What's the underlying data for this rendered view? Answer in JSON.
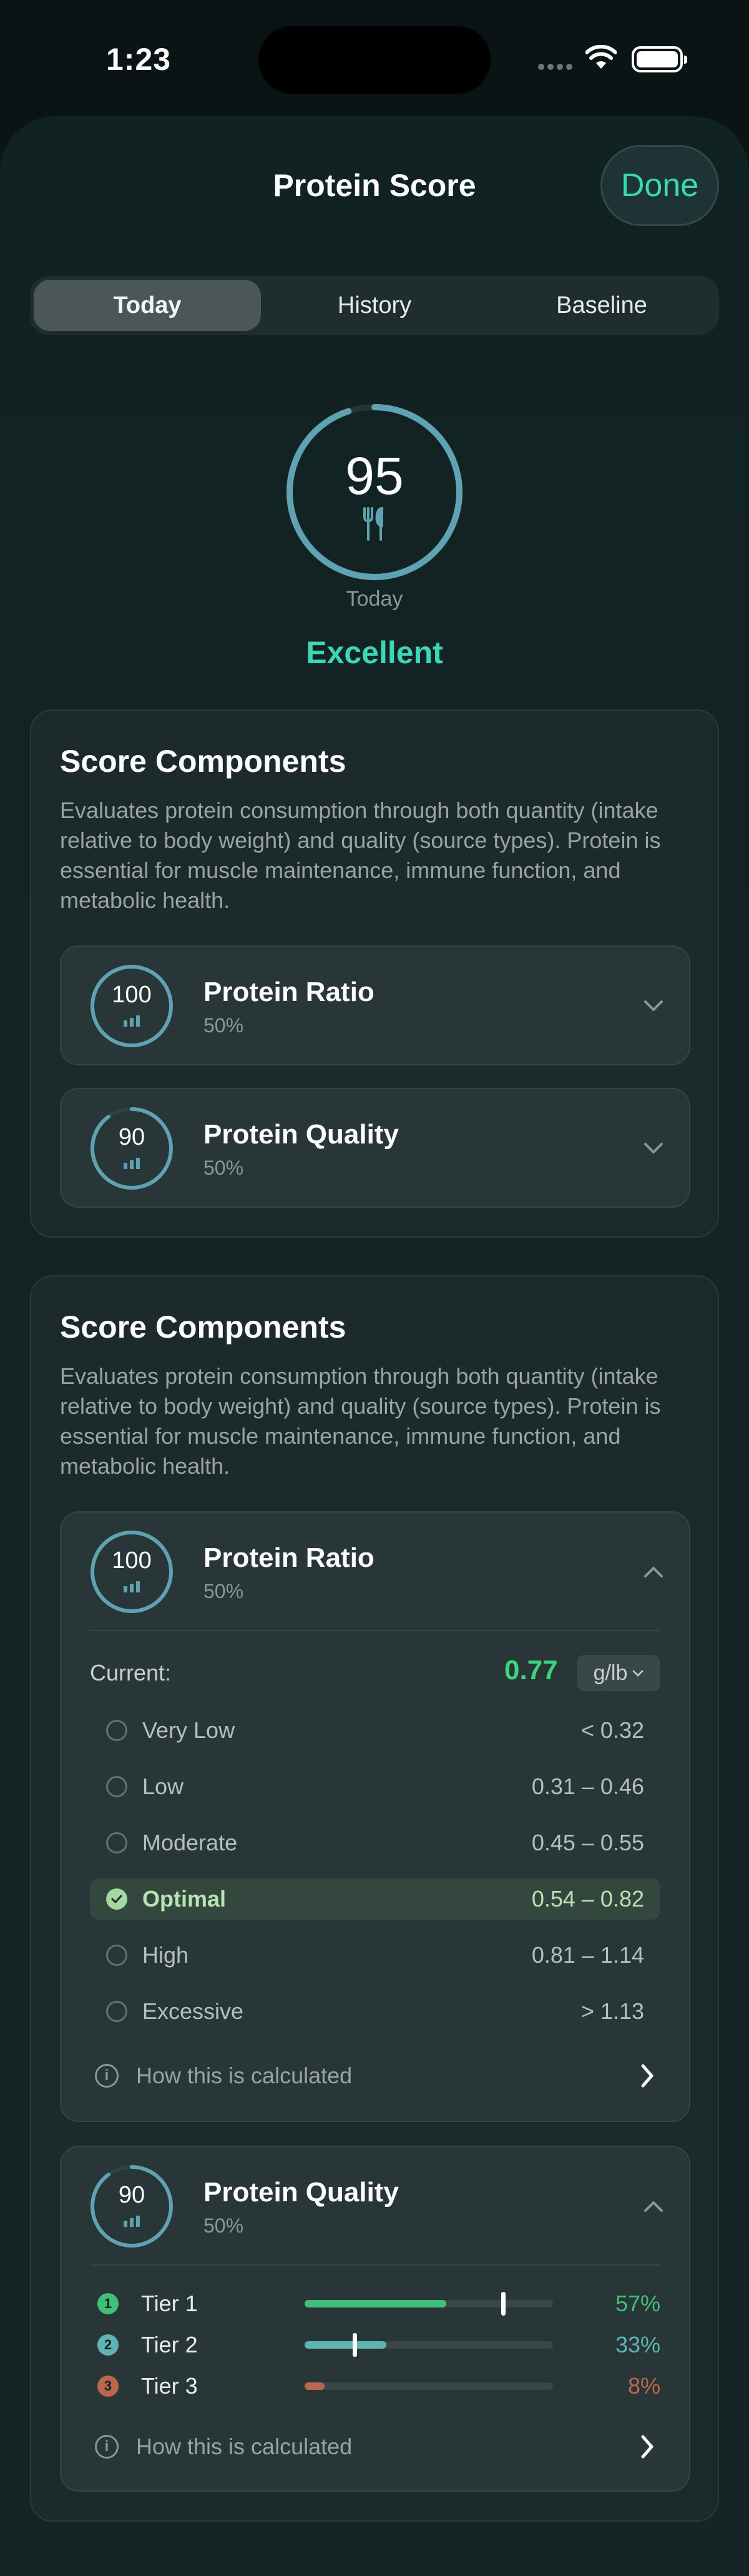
{
  "status": {
    "time": "1:23"
  },
  "header": {
    "title": "Protein Score",
    "done_label": "Done"
  },
  "tabs": [
    {
      "label": "Today",
      "active": true
    },
    {
      "label": "History",
      "active": false
    },
    {
      "label": "Baseline",
      "active": false
    }
  ],
  "score": {
    "value": "95",
    "period": "Today",
    "rating": "Excellent",
    "ring_fraction": 0.95,
    "icon": "fork-knife-icon"
  },
  "colors": {
    "accent": "#3dd6b6",
    "ring": "#5fa3b3",
    "current_value": "#3fd47f",
    "tier1": "#3fbf7a",
    "tier2": "#5fb3b3",
    "tier3": "#b8694c"
  },
  "collapsed_card": {
    "title": "Score Components",
    "description": "Evaluates protein consumption through both quantity (intake relative to body weight) and quality (source types). Protein is essential for muscle maintenance, immune function, and metabolic health.",
    "components": [
      {
        "score": "100",
        "name": "Protein Ratio",
        "weight": "50%",
        "ring_fraction": 1.0
      },
      {
        "score": "90",
        "name": "Protein Quality",
        "weight": "50%",
        "ring_fraction": 0.9
      }
    ]
  },
  "expanded_card": {
    "title": "Score Components",
    "description": "Evaluates protein consumption through both quantity (intake relative to body weight) and quality (source types). Protein is essential for muscle maintenance, immune function, and metabolic health.",
    "ratio": {
      "score": "100",
      "name": "Protein Ratio",
      "weight": "50%",
      "ring_fraction": 1.0,
      "current_label": "Current:",
      "current_value": "0.77",
      "unit": "g/lb",
      "ranges": [
        {
          "label": "Very Low",
          "value": "< 0.32",
          "selected": false
        },
        {
          "label": "Low",
          "value": "0.31 – 0.46",
          "selected": false
        },
        {
          "label": "Moderate",
          "value": "0.45 – 0.55",
          "selected": false
        },
        {
          "label": "Optimal",
          "value": "0.54 – 0.82",
          "selected": true
        },
        {
          "label": "High",
          "value": "0.81 – 1.14",
          "selected": false
        },
        {
          "label": "Excessive",
          "value": "> 1.13",
          "selected": false
        }
      ],
      "how_label": "How this is calculated"
    },
    "quality": {
      "score": "90",
      "name": "Protein Quality",
      "weight": "50%",
      "ring_fraction": 0.9,
      "tiers": [
        {
          "num": "1",
          "name": "Tier 1",
          "pct": "57%",
          "fill": 0.57,
          "marker": 0.8
        },
        {
          "num": "2",
          "name": "Tier 2",
          "pct": "33%",
          "fill": 0.33,
          "marker": 0.2
        },
        {
          "num": "3",
          "name": "Tier 3",
          "pct": "8%",
          "fill": 0.08,
          "marker": null
        }
      ],
      "how_label": "How this is calculated"
    }
  }
}
